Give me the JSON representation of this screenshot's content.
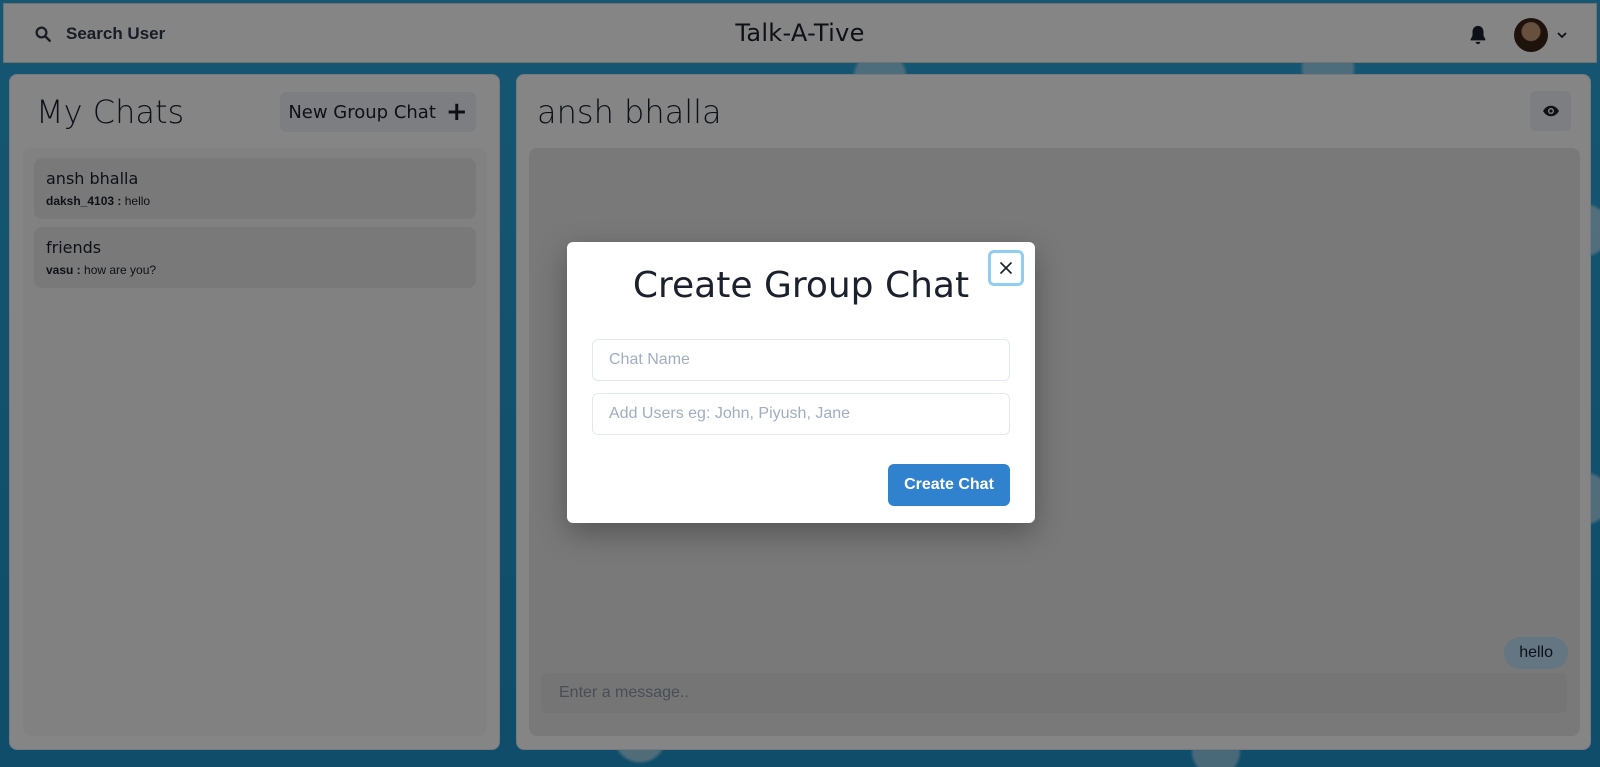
{
  "header": {
    "search_label": "Search User",
    "app_title": "Talk-A-Tive",
    "icons": {
      "search": "search-icon",
      "notifications": "bell-icon",
      "profile_menu": "chevron-down-icon"
    }
  },
  "sidebar": {
    "title": "My Chats",
    "new_group_label": "New Group Chat",
    "new_group_icon": "+",
    "chats": [
      {
        "name": "ansh bhalla",
        "latest_sender": "daksh_4103 :",
        "latest_message": "hello"
      },
      {
        "name": "friends",
        "latest_sender": "vasu :",
        "latest_message": "how are you?"
      }
    ]
  },
  "chat": {
    "title": "ansh bhalla",
    "view_icon": "eye-icon",
    "messages": [
      {
        "text": "hello",
        "own": true
      }
    ],
    "input_placeholder": "Enter a message.."
  },
  "modal": {
    "title": "Create Group Chat",
    "chat_name_placeholder": "Chat Name",
    "add_users_placeholder": "Add Users eg: John, Piyush, Jane",
    "submit_label": "Create Chat",
    "close_icon": "close-icon"
  },
  "colors": {
    "primary": "#3182ce",
    "background": "#2aa6dc",
    "own_message_bubble": "#bee3f8",
    "close_focus_ring": "#90cdf4"
  }
}
